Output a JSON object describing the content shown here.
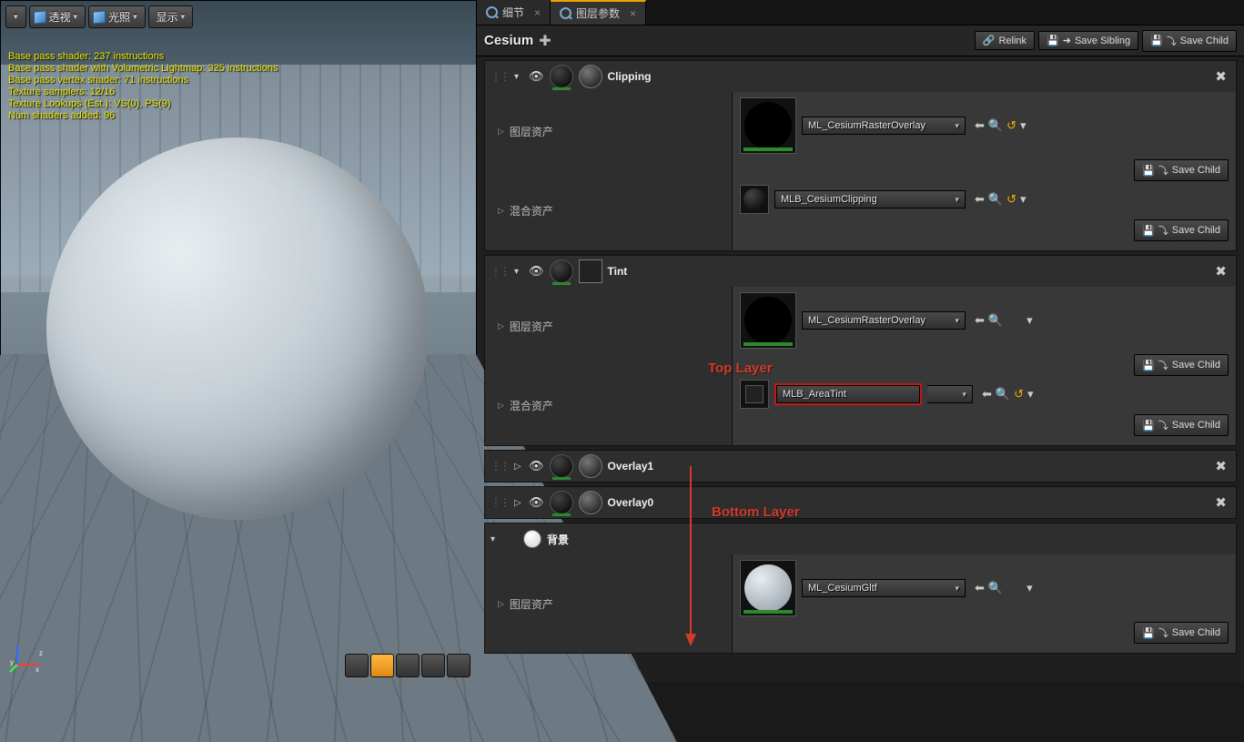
{
  "viewport": {
    "toolbar": {
      "perspective": "透视",
      "lit": "光照",
      "show": "显示"
    },
    "stats": "Base pass shader: 237 instructions\nBase pass shader with Volumetric Lightmap: 325 instructions\nBase pass vertex shader: 71 instructions\nTexture samplers: 12/16\nTexture Lookups (Est.): VS(0), PS(9)\nNum shaders added: 96"
  },
  "tabs": {
    "details": "细节",
    "layerParams": "图层参数"
  },
  "header": {
    "title": "Cesium",
    "relink": "Relink",
    "saveSibling": "Save Sibling",
    "saveChild": "Save Child"
  },
  "common": {
    "layerAsset": "图层资产",
    "blendAsset": "混合资产",
    "saveChild": "Save Child"
  },
  "layers": {
    "clipping": {
      "name": "Clipping",
      "layerAssetValue": "ML_CesiumRasterOverlay",
      "blendAssetValue": "MLB_CesiumClipping"
    },
    "tint": {
      "name": "Tint",
      "layerAssetValue": "ML_CesiumRasterOverlay",
      "blendAssetValue": "MLB_AreaTint"
    },
    "overlay1": {
      "name": "Overlay1"
    },
    "overlay0": {
      "name": "Overlay0"
    },
    "background": {
      "name": "背景",
      "layerAssetValue": "ML_CesiumGltf"
    }
  },
  "annotations": {
    "top": "Top Layer",
    "bottom": "Bottom Layer"
  }
}
